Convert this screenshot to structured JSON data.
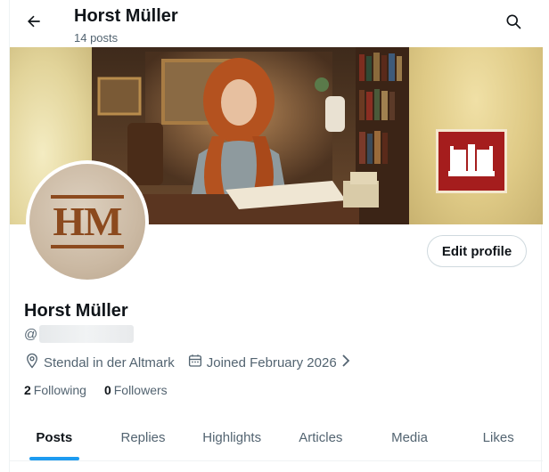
{
  "header": {
    "title": "Horst Müller",
    "posts_count": "14 posts",
    "back_icon": "arrow-left-icon",
    "search_icon": "search-icon"
  },
  "banner": {
    "description_icon": "book-icon"
  },
  "avatar": {
    "monogram": "HM"
  },
  "profile": {
    "name": "Horst Müller",
    "handle_prefix": "@",
    "location": "Stendal in der Altmark",
    "joined": "Joined February 2026",
    "edit_label": "Edit profile"
  },
  "stats": {
    "following_count": "2",
    "following_label": "Following",
    "followers_count": "0",
    "followers_label": "Followers"
  },
  "tabs": [
    {
      "label": "Posts",
      "active": true
    },
    {
      "label": "Replies",
      "active": false
    },
    {
      "label": "Highlights",
      "active": false
    },
    {
      "label": "Articles",
      "active": false
    },
    {
      "label": "Media",
      "active": false
    },
    {
      "label": "Likes",
      "active": false
    }
  ],
  "colors": {
    "accent": "#1d9bf0",
    "brand_red": "#a51d1d",
    "monogram_brown": "#8c4a1e",
    "text_primary": "#0f1419",
    "text_secondary": "#536471"
  }
}
